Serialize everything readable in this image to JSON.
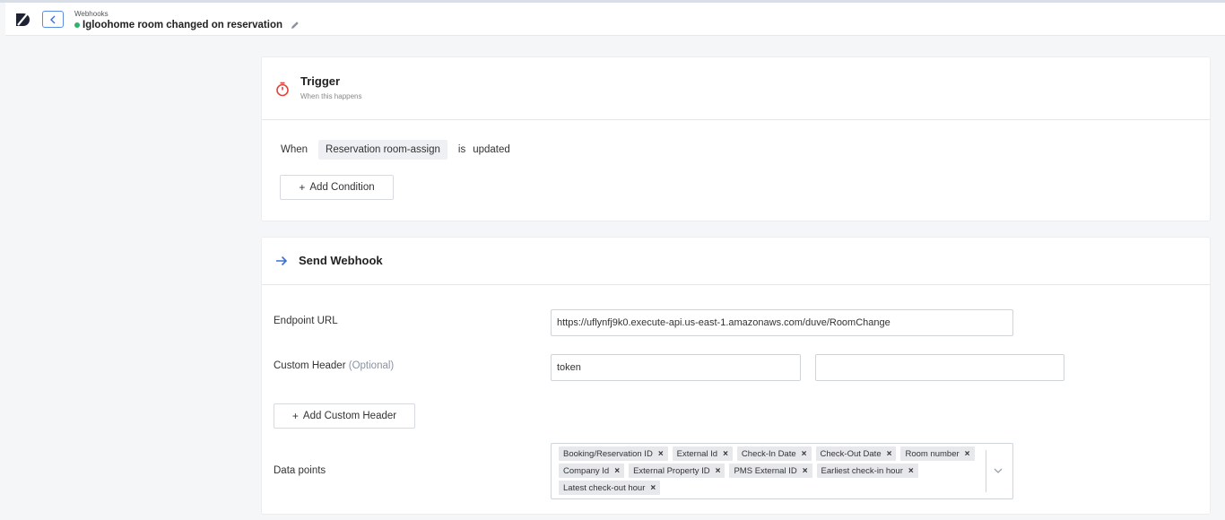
{
  "header": {
    "breadcrumb": "Webhooks",
    "title": "Igloohome room changed on reservation",
    "status_color": "#2fb36a"
  },
  "trigger": {
    "title": "Trigger",
    "subtitle": "When this happens",
    "condition": {
      "when": "When",
      "field": "Reservation room-assign",
      "is": "is",
      "value": "updated"
    },
    "add_condition_label": "Add Condition"
  },
  "webhook": {
    "title": "Send Webhook",
    "endpoint_label": "Endpoint URL",
    "endpoint_value": "https://uflynfj9k0.execute-api.us-east-1.amazonaws.com/duve/RoomChange",
    "custom_header_label": "Custom Header",
    "custom_header_optional": "(Optional)",
    "custom_header_key": "token",
    "custom_header_value": "",
    "add_custom_header_label": "Add Custom Header",
    "data_points_label": "Data points",
    "data_points": [
      "Booking/Reservation ID",
      "External Id",
      "Check-In Date",
      "Check-Out Date",
      "Room number",
      "Company Id",
      "External Property ID",
      "PMS External ID",
      "Earliest check-in hour",
      "Latest check-out hour"
    ]
  },
  "icons": {
    "logo": "duve-logo-icon",
    "back": "chevron-left-icon",
    "edit": "pencil-icon",
    "trigger": "stopwatch-icon",
    "webhook": "arrow-right-icon",
    "remove": "close-icon",
    "dropdown": "chevron-down-icon"
  },
  "colors": {
    "accent": "#3b6fd6",
    "trigger_icon": "#e0443c"
  }
}
